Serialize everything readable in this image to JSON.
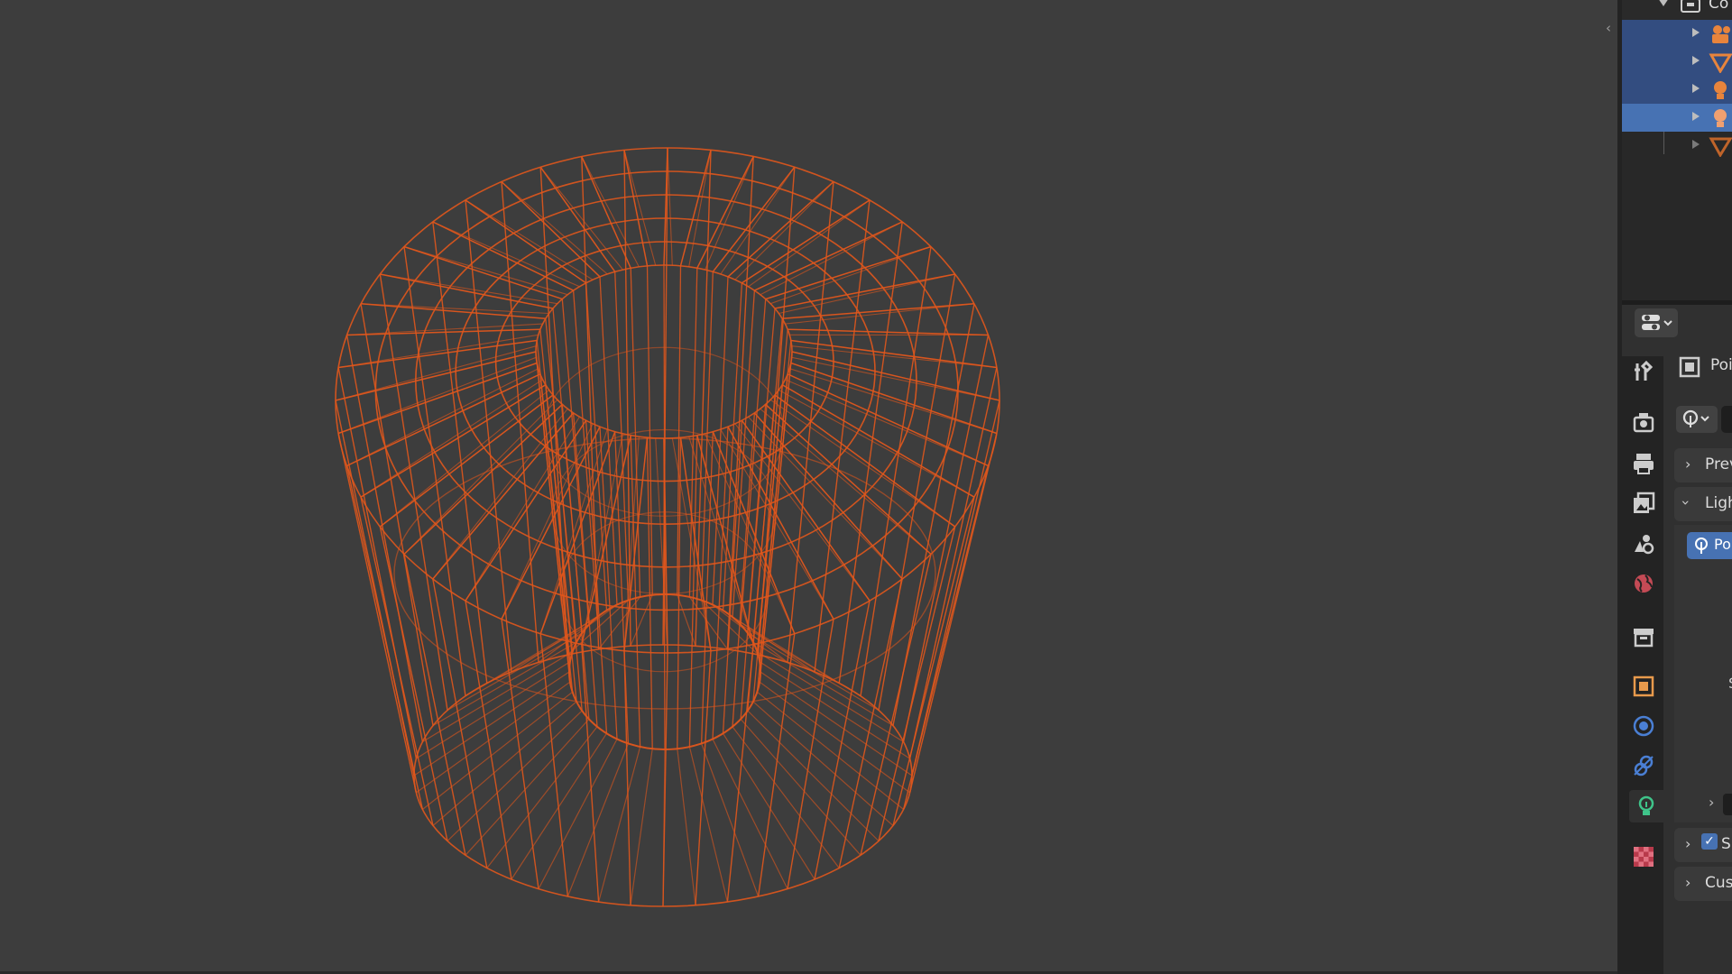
{
  "viewport": {
    "background": "#3d3d3d",
    "wire_color": "#e0561c",
    "collapse_icon": "chevron-left-icon"
  },
  "outliner": {
    "root_label": "Co",
    "items": [
      {
        "icon": "camera-icon",
        "label": ""
      },
      {
        "icon": "mesh-icon",
        "label": ""
      },
      {
        "icon": "light-icon",
        "label": ""
      },
      {
        "icon": "light-icon",
        "label": "",
        "active": true
      },
      {
        "icon": "mesh-icon",
        "label": ""
      }
    ]
  },
  "properties": {
    "editor_type_icon": "properties-editor-icon",
    "tabs": [
      {
        "icon": "tool-icon"
      },
      {
        "icon": "render-icon"
      },
      {
        "icon": "output-icon"
      },
      {
        "icon": "view-layer-icon"
      },
      {
        "icon": "scene-icon"
      },
      {
        "icon": "world-icon"
      },
      {
        "icon": "collection-icon"
      },
      {
        "icon": "object-icon"
      },
      {
        "icon": "modifier-icon"
      },
      {
        "icon": "constraint-icon"
      },
      {
        "icon": "light-data-icon",
        "active": true
      },
      {
        "icon": "texture-icon"
      }
    ],
    "header_label": "Poi",
    "panels": {
      "preview": "Prev",
      "light": "Ligh",
      "light_type": "Po",
      "clipped_row": "S",
      "shadow": "S",
      "custom": "Cus"
    }
  }
}
